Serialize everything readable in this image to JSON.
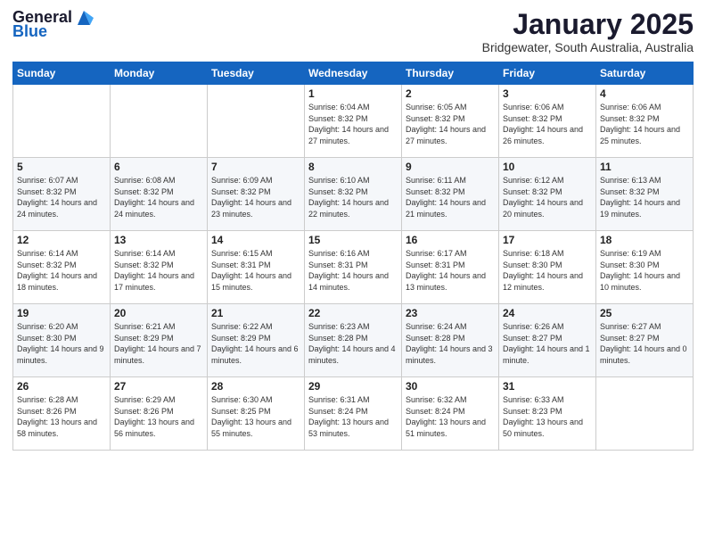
{
  "logo": {
    "general": "General",
    "blue": "Blue"
  },
  "title": "January 2025",
  "subtitle": "Bridgewater, South Australia, Australia",
  "weekdays": [
    "Sunday",
    "Monday",
    "Tuesday",
    "Wednesday",
    "Thursday",
    "Friday",
    "Saturday"
  ],
  "weeks": [
    [
      {
        "day": "",
        "sunrise": "",
        "sunset": "",
        "daylight": ""
      },
      {
        "day": "",
        "sunrise": "",
        "sunset": "",
        "daylight": ""
      },
      {
        "day": "",
        "sunrise": "",
        "sunset": "",
        "daylight": ""
      },
      {
        "day": "1",
        "sunrise": "Sunrise: 6:04 AM",
        "sunset": "Sunset: 8:32 PM",
        "daylight": "Daylight: 14 hours and 27 minutes."
      },
      {
        "day": "2",
        "sunrise": "Sunrise: 6:05 AM",
        "sunset": "Sunset: 8:32 PM",
        "daylight": "Daylight: 14 hours and 27 minutes."
      },
      {
        "day": "3",
        "sunrise": "Sunrise: 6:06 AM",
        "sunset": "Sunset: 8:32 PM",
        "daylight": "Daylight: 14 hours and 26 minutes."
      },
      {
        "day": "4",
        "sunrise": "Sunrise: 6:06 AM",
        "sunset": "Sunset: 8:32 PM",
        "daylight": "Daylight: 14 hours and 25 minutes."
      }
    ],
    [
      {
        "day": "5",
        "sunrise": "Sunrise: 6:07 AM",
        "sunset": "Sunset: 8:32 PM",
        "daylight": "Daylight: 14 hours and 24 minutes."
      },
      {
        "day": "6",
        "sunrise": "Sunrise: 6:08 AM",
        "sunset": "Sunset: 8:32 PM",
        "daylight": "Daylight: 14 hours and 24 minutes."
      },
      {
        "day": "7",
        "sunrise": "Sunrise: 6:09 AM",
        "sunset": "Sunset: 8:32 PM",
        "daylight": "Daylight: 14 hours and 23 minutes."
      },
      {
        "day": "8",
        "sunrise": "Sunrise: 6:10 AM",
        "sunset": "Sunset: 8:32 PM",
        "daylight": "Daylight: 14 hours and 22 minutes."
      },
      {
        "day": "9",
        "sunrise": "Sunrise: 6:11 AM",
        "sunset": "Sunset: 8:32 PM",
        "daylight": "Daylight: 14 hours and 21 minutes."
      },
      {
        "day": "10",
        "sunrise": "Sunrise: 6:12 AM",
        "sunset": "Sunset: 8:32 PM",
        "daylight": "Daylight: 14 hours and 20 minutes."
      },
      {
        "day": "11",
        "sunrise": "Sunrise: 6:13 AM",
        "sunset": "Sunset: 8:32 PM",
        "daylight": "Daylight: 14 hours and 19 minutes."
      }
    ],
    [
      {
        "day": "12",
        "sunrise": "Sunrise: 6:14 AM",
        "sunset": "Sunset: 8:32 PM",
        "daylight": "Daylight: 14 hours and 18 minutes."
      },
      {
        "day": "13",
        "sunrise": "Sunrise: 6:14 AM",
        "sunset": "Sunset: 8:32 PM",
        "daylight": "Daylight: 14 hours and 17 minutes."
      },
      {
        "day": "14",
        "sunrise": "Sunrise: 6:15 AM",
        "sunset": "Sunset: 8:31 PM",
        "daylight": "Daylight: 14 hours and 15 minutes."
      },
      {
        "day": "15",
        "sunrise": "Sunrise: 6:16 AM",
        "sunset": "Sunset: 8:31 PM",
        "daylight": "Daylight: 14 hours and 14 minutes."
      },
      {
        "day": "16",
        "sunrise": "Sunrise: 6:17 AM",
        "sunset": "Sunset: 8:31 PM",
        "daylight": "Daylight: 14 hours and 13 minutes."
      },
      {
        "day": "17",
        "sunrise": "Sunrise: 6:18 AM",
        "sunset": "Sunset: 8:30 PM",
        "daylight": "Daylight: 14 hours and 12 minutes."
      },
      {
        "day": "18",
        "sunrise": "Sunrise: 6:19 AM",
        "sunset": "Sunset: 8:30 PM",
        "daylight": "Daylight: 14 hours and 10 minutes."
      }
    ],
    [
      {
        "day": "19",
        "sunrise": "Sunrise: 6:20 AM",
        "sunset": "Sunset: 8:30 PM",
        "daylight": "Daylight: 14 hours and 9 minutes."
      },
      {
        "day": "20",
        "sunrise": "Sunrise: 6:21 AM",
        "sunset": "Sunset: 8:29 PM",
        "daylight": "Daylight: 14 hours and 7 minutes."
      },
      {
        "day": "21",
        "sunrise": "Sunrise: 6:22 AM",
        "sunset": "Sunset: 8:29 PM",
        "daylight": "Daylight: 14 hours and 6 minutes."
      },
      {
        "day": "22",
        "sunrise": "Sunrise: 6:23 AM",
        "sunset": "Sunset: 8:28 PM",
        "daylight": "Daylight: 14 hours and 4 minutes."
      },
      {
        "day": "23",
        "sunrise": "Sunrise: 6:24 AM",
        "sunset": "Sunset: 8:28 PM",
        "daylight": "Daylight: 14 hours and 3 minutes."
      },
      {
        "day": "24",
        "sunrise": "Sunrise: 6:26 AM",
        "sunset": "Sunset: 8:27 PM",
        "daylight": "Daylight: 14 hours and 1 minute."
      },
      {
        "day": "25",
        "sunrise": "Sunrise: 6:27 AM",
        "sunset": "Sunset: 8:27 PM",
        "daylight": "Daylight: 14 hours and 0 minutes."
      }
    ],
    [
      {
        "day": "26",
        "sunrise": "Sunrise: 6:28 AM",
        "sunset": "Sunset: 8:26 PM",
        "daylight": "Daylight: 13 hours and 58 minutes."
      },
      {
        "day": "27",
        "sunrise": "Sunrise: 6:29 AM",
        "sunset": "Sunset: 8:26 PM",
        "daylight": "Daylight: 13 hours and 56 minutes."
      },
      {
        "day": "28",
        "sunrise": "Sunrise: 6:30 AM",
        "sunset": "Sunset: 8:25 PM",
        "daylight": "Daylight: 13 hours and 55 minutes."
      },
      {
        "day": "29",
        "sunrise": "Sunrise: 6:31 AM",
        "sunset": "Sunset: 8:24 PM",
        "daylight": "Daylight: 13 hours and 53 minutes."
      },
      {
        "day": "30",
        "sunrise": "Sunrise: 6:32 AM",
        "sunset": "Sunset: 8:24 PM",
        "daylight": "Daylight: 13 hours and 51 minutes."
      },
      {
        "day": "31",
        "sunrise": "Sunrise: 6:33 AM",
        "sunset": "Sunset: 8:23 PM",
        "daylight": "Daylight: 13 hours and 50 minutes."
      },
      {
        "day": "",
        "sunrise": "",
        "sunset": "",
        "daylight": ""
      }
    ]
  ]
}
